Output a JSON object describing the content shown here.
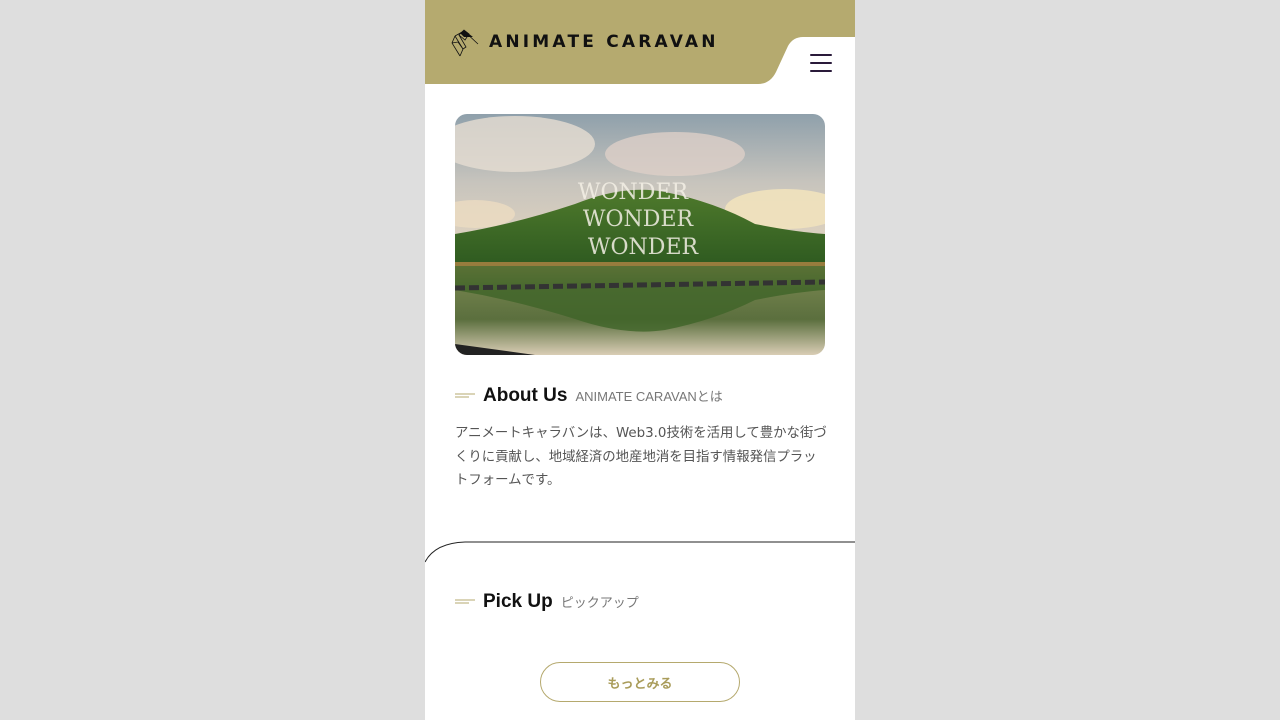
{
  "header": {
    "brand": "ANIMATE CARAVAN",
    "bg_color": "#b5aa6f",
    "logo_icon": "animate-caravan-logo-mark",
    "menu_icon": "hamburger-menu-icon"
  },
  "hero": {
    "overlay_text": [
      "WONDER",
      "WONDER",
      "WONDER"
    ],
    "alt": "lake-hill-reflection-photo"
  },
  "about": {
    "title": "About Us",
    "subtitle": "ANIMATE CARAVANとは",
    "body": "アニメートキャラバンは、Web3.0技術を活用して豊かな街づくりに貢献し、地域経済の地産地消を目指す情報発信プラットフォームです。"
  },
  "pickup": {
    "title": "Pick Up",
    "subtitle": "ピックアップ",
    "more_label": "もっとみる"
  },
  "colors": {
    "accent": "#b5aa6f",
    "page_bg": "#dedede",
    "text": "#555555"
  }
}
